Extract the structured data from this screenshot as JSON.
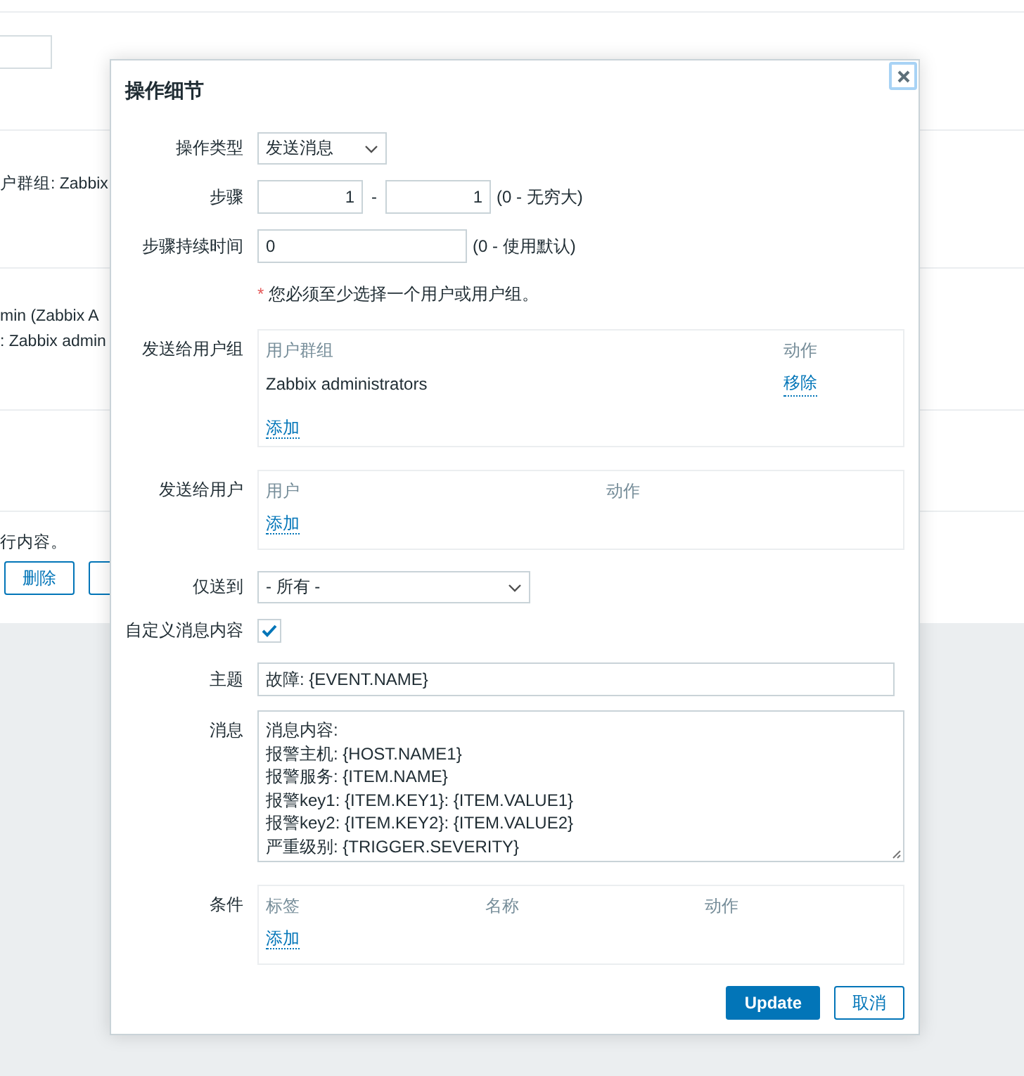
{
  "background_page": {
    "group_line": "户群组: Zabbix",
    "user_line": "min (Zabbix A",
    "group_line_2": ": Zabbix admin",
    "note": "行内容。",
    "buttons": [
      "删除"
    ]
  },
  "dialog": {
    "title": "操作细节",
    "operation_type": {
      "label": "操作类型",
      "value": "发送消息"
    },
    "steps": {
      "label": "步骤",
      "from": "1",
      "separator": "-",
      "to": "1",
      "hint": "(0 - 无穷大)"
    },
    "step_duration": {
      "label": "步骤持续时间",
      "value": "0",
      "hint": "(0 - 使用默认)"
    },
    "required_note": {
      "mark": "*",
      "text": "您必须至少选择一个用户或用户组。"
    },
    "user_groups": {
      "label": "发送给用户组",
      "columns": [
        "用户群组",
        "动作"
      ],
      "rows": [
        {
          "name": "Zabbix administrators",
          "action": "移除"
        }
      ],
      "add": "添加"
    },
    "users": {
      "label": "发送给用户",
      "columns": [
        "用户",
        "动作"
      ],
      "add": "添加"
    },
    "send_only_to": {
      "label": "仅送到",
      "value": "- 所有 -"
    },
    "custom_message": {
      "label": "自定义消息内容",
      "checked": true
    },
    "subject": {
      "label": "主题",
      "value": "故障: {EVENT.NAME}"
    },
    "message": {
      "label": "消息",
      "lines": [
        "消息内容:",
        "报警主机: {HOST.NAME1}",
        "报警服务: {ITEM.NAME}",
        "报警key1: {ITEM.KEY1}: {ITEM.VALUE1}",
        "报警key2: {ITEM.KEY2}: {ITEM.VALUE2}",
        "严重级别: {TRIGGER.SEVERITY}"
      ]
    },
    "conditions": {
      "label": "条件",
      "columns": [
        "标签",
        "名称",
        "动作"
      ],
      "add": "添加"
    },
    "buttons": [
      {
        "label": "Update",
        "kind": "primary"
      },
      {
        "label": "取消",
        "kind": "secondary"
      }
    ]
  }
}
